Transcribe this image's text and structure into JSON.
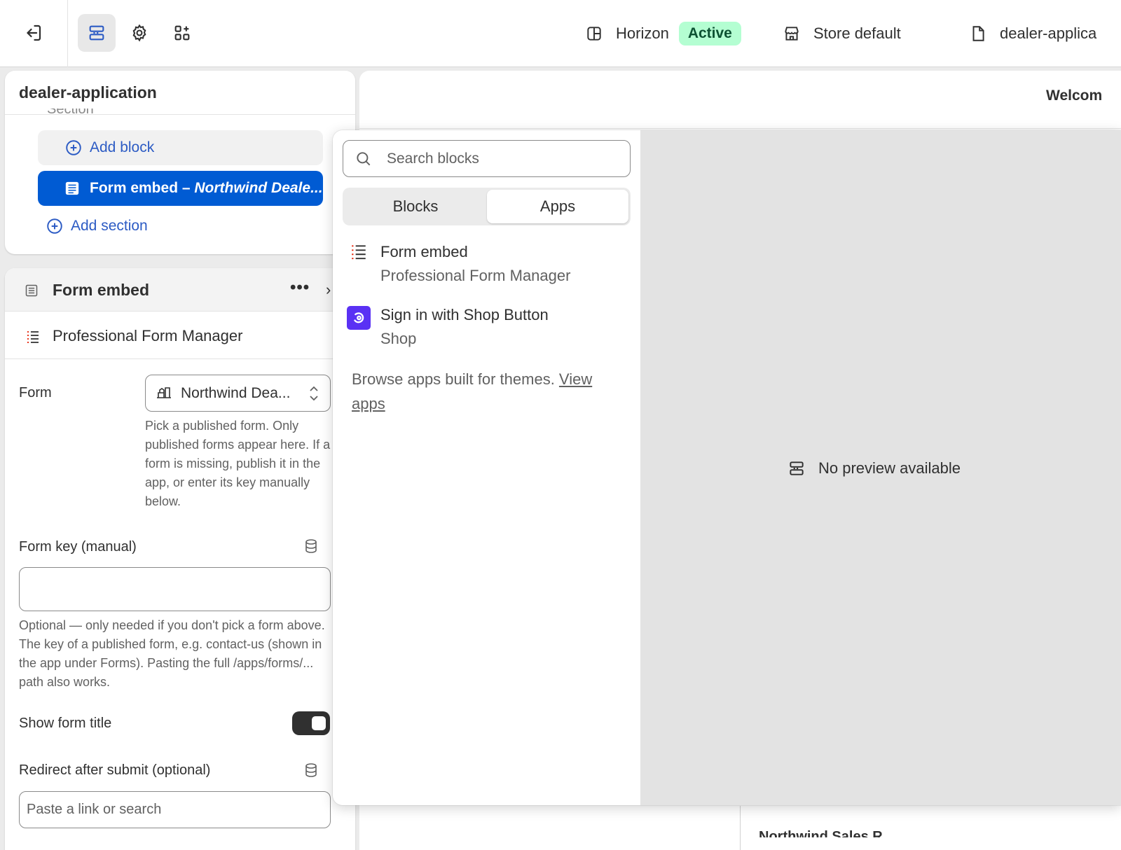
{
  "topbar": {
    "theme_name": "Horizon",
    "theme_status": "Active",
    "store_context": "Store default",
    "template_name": "dealer-applica"
  },
  "sections_panel": {
    "title": "dealer-application",
    "hidden_row_label": "Section",
    "add_block_label": "Add block",
    "selected_block_name": "Form embed",
    "selected_block_separator": " – ",
    "selected_block_detail": "Northwind Deale...",
    "add_section_label": "Add section"
  },
  "settings_panel": {
    "title": "Form embed",
    "more_label": "•••",
    "close_glyph": "›",
    "app_name": "Professional Form Manager",
    "form_label": "Form",
    "form_value": "Northwind Dea...",
    "form_help": "Pick a published form. Only published forms appear here. If a form is missing, publish it in the app, or enter its key manually below.",
    "form_key_label": "Form key (manual)",
    "form_key_value": "",
    "form_key_help": "Optional — only needed if you don't pick a form above. The key of a published form, e.g. contact-us (shown in the app under Forms). Pasting the full /apps/forms/... path also works.",
    "show_title_label": "Show form title",
    "show_title_on": true,
    "redirect_label": "Redirect after submit (optional)",
    "redirect_placeholder": "Paste a link or search"
  },
  "preview": {
    "welcome_text": "Welcom",
    "lower_text": "Northwind Sales R"
  },
  "block_picker": {
    "search_placeholder": "Search blocks",
    "tabs": [
      {
        "label": "Blocks",
        "selected": false
      },
      {
        "label": "Apps",
        "selected": true
      }
    ],
    "apps": [
      {
        "name": "Form embed",
        "provider": "Professional Form Manager",
        "icon": "list-form-icon"
      },
      {
        "name": "Sign in with Shop Button",
        "provider": "Shop",
        "icon": "shop-logo-icon"
      }
    ],
    "browse_text": "Browse apps built for themes. ",
    "browse_link": "View apps",
    "no_preview_text": "No preview available"
  },
  "colors": {
    "accent_blue": "#005bd3",
    "link_blue": "#2c5bc4",
    "active_badge_bg": "#b4fed2",
    "active_badge_text": "#0c5132",
    "shop_purple": "#5a31f4"
  }
}
